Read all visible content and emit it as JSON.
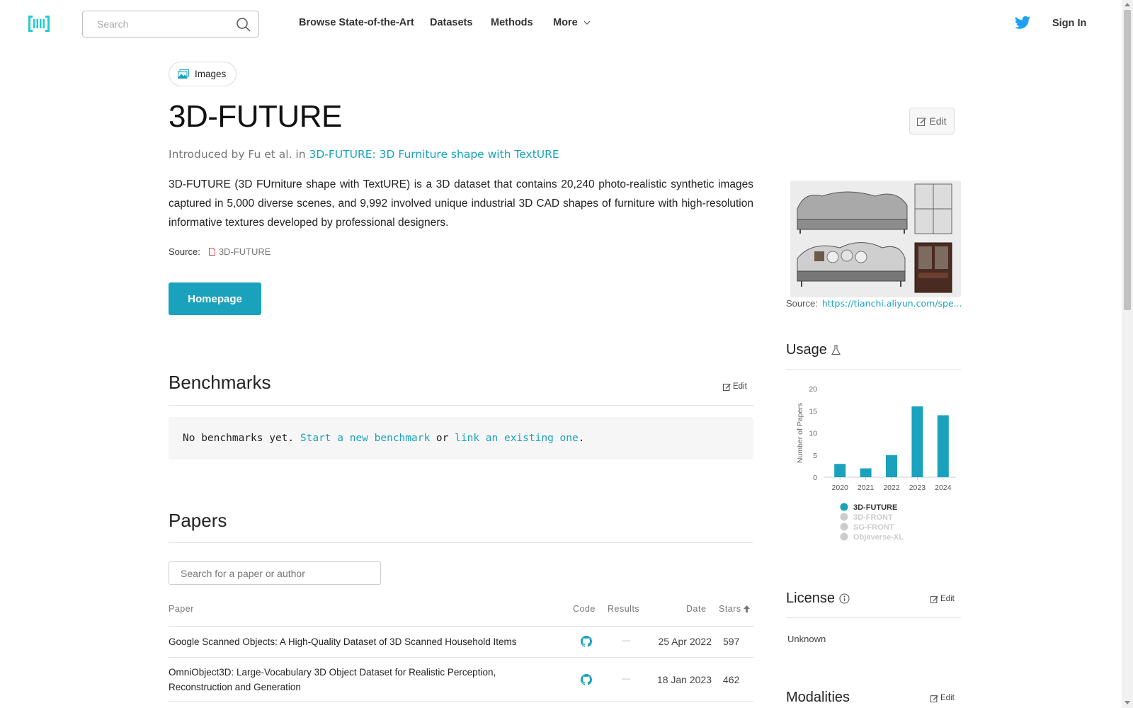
{
  "nav": {
    "search_placeholder": "Search",
    "links": [
      "Browse State-of-the-Art",
      "Datasets",
      "Methods",
      "More"
    ],
    "sign_in": "Sign In"
  },
  "dataset": {
    "modality": "Images",
    "title": "3D-FUTURE",
    "edit_label": "Edit",
    "intro_prefix": "Introduced by Fu et al. in ",
    "intro_paper": "3D-FUTURE: 3D Furniture shape with TextURE",
    "description": "3D-FUTURE (3D FUrniture shape with TextURE) is a 3D dataset that contains 20,240 photo-realistic synthetic images captured in 5,000 diverse scenes, and 9,992 involved unique industrial 3D CAD shapes of furniture with high-resolution informative textures developed by professional designers.",
    "source_label": "Source:",
    "source_link": "3D-FUTURE",
    "homepage_label": "Homepage"
  },
  "benchmarks": {
    "heading": "Benchmarks",
    "edit_label": "Edit",
    "empty_prefix": "No benchmarks yet. ",
    "start_link": "Start a new benchmark",
    "or_text": " or ",
    "link_existing": "link an existing one",
    "period": "."
  },
  "papers": {
    "heading": "Papers",
    "search_placeholder": "Search for a paper or author",
    "columns": {
      "paper": "Paper",
      "code": "Code",
      "results": "Results",
      "date": "Date",
      "stars": "Stars"
    },
    "rows": [
      {
        "title": "Google Scanned Objects: A High-Quality Dataset of 3D Scanned Household Items",
        "results": "—",
        "date": "25 Apr 2022",
        "stars": "597"
      },
      {
        "title": "OmniObject3D: Large-Vocabulary 3D Object Dataset for Realistic Perception, Reconstruction and Generation",
        "results": "—",
        "date": "18 Jan 2023",
        "stars": "462"
      }
    ]
  },
  "sidebar": {
    "image_source_label": "Source:",
    "image_source_link": "https://tianchi.aliyun.com/spe...",
    "usage_heading": "Usage",
    "license_heading": "License",
    "license_edit": "Edit",
    "license_value": "Unknown",
    "modalities_heading": "Modalities",
    "modalities_edit": "Edit"
  },
  "colors": {
    "accent": "#1aa2bc",
    "legend_inactive": "#cccccc"
  },
  "chart_data": {
    "type": "bar",
    "categories": [
      "2020",
      "2021",
      "2022",
      "2023",
      "2024"
    ],
    "values": [
      3,
      2,
      5,
      16,
      14
    ],
    "ylabel": "Number of Papers",
    "yticks": [
      0,
      5,
      10,
      15,
      20
    ],
    "ylim": [
      0,
      20
    ],
    "legend": [
      {
        "name": "3D-FUTURE",
        "active": true
      },
      {
        "name": "3D-FRONT",
        "active": false
      },
      {
        "name": "SG-FRONT",
        "active": false
      },
      {
        "name": "Objaverse-XL",
        "active": false
      }
    ],
    "legend_position": "bottom"
  }
}
